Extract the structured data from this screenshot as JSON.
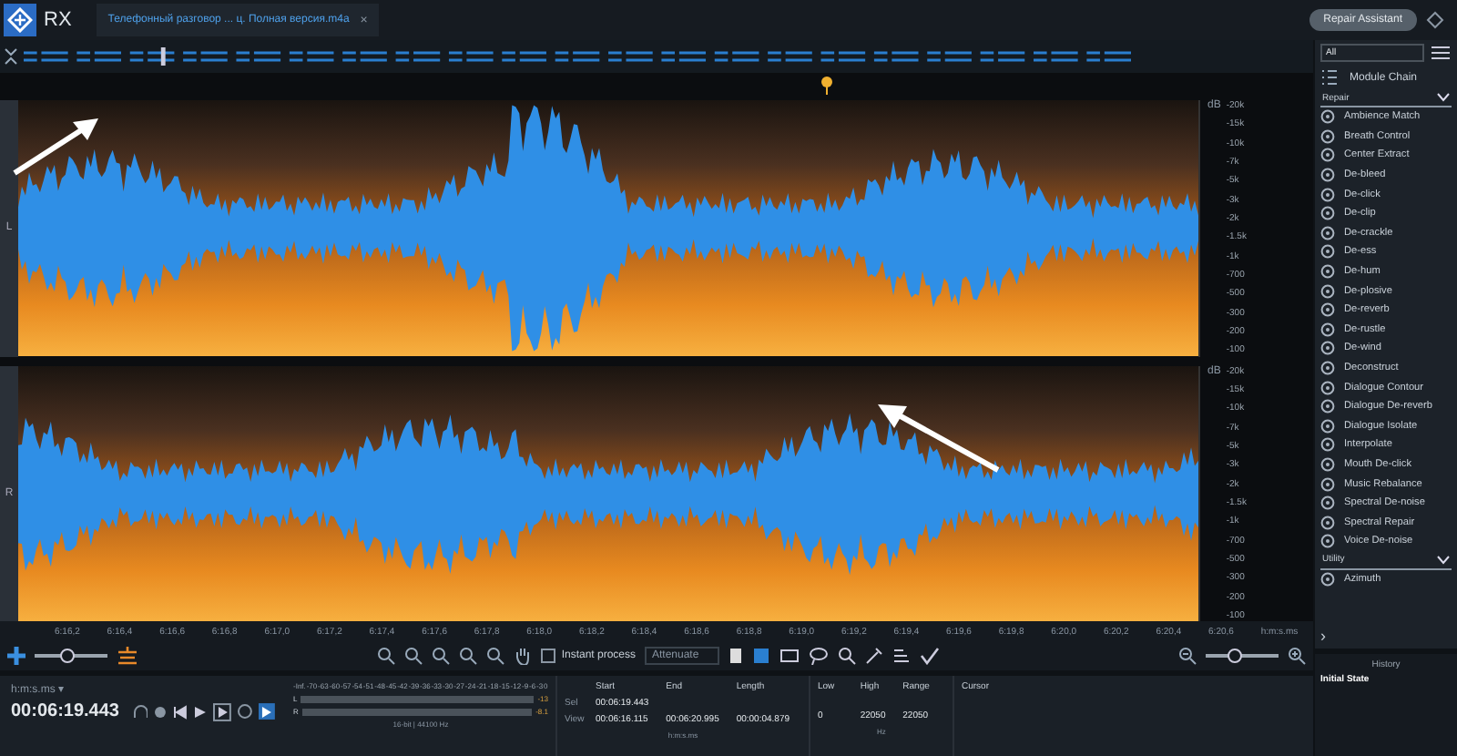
{
  "app": {
    "logo": "RX",
    "tab": {
      "title": "Телефонный разговор ... ц. Полная версия.m4a",
      "close": "×",
      "selected": true
    },
    "assistant_button": "Repair Assistant"
  },
  "channels": [
    {
      "label": "L",
      "db_label": "dB",
      "hz_ticks": [
        "-20k",
        "-15k",
        "-10k",
        "-7k",
        "-5k",
        "-3k",
        "-2k",
        "-1.5k",
        "-1k",
        "-700",
        "-500",
        "-300",
        "-200",
        "-100"
      ]
    },
    {
      "label": "R",
      "db_label": "dB",
      "hz_ticks": [
        "-20k",
        "-15k",
        "-10k",
        "-7k",
        "-5k",
        "-3k",
        "-2k",
        "-1.5k",
        "-1k",
        "-700",
        "-500",
        "-300",
        "-200",
        "-100"
      ]
    }
  ],
  "ruler": {
    "ticks": [
      "6:16,2",
      "6:16,4",
      "6:16,6",
      "6:16,8",
      "6:17,0",
      "6:17,2",
      "6:17,4",
      "6:17,6",
      "6:17,8",
      "6:18,0",
      "6:18,2",
      "6:18,4",
      "6:18,6",
      "6:18,8",
      "6:19,0",
      "6:19,2",
      "6:19,4",
      "6:19,6",
      "6:19,8",
      "6:20,0",
      "6:20,2",
      "6:20,4",
      "6:20,6"
    ],
    "unit": "h:m:s.ms"
  },
  "toolbar": {
    "left_zoom": {
      "level": 0.45
    },
    "instant_process": {
      "label": "Instant process",
      "checked": false
    },
    "mode": "Attenuate",
    "right_zoom": {
      "level": 0.4
    }
  },
  "transport": {
    "format": "h:m:s.ms ▾",
    "time": "00:06:19.443"
  },
  "meter": {
    "scale": [
      "-Inf.",
      "-70",
      "-63",
      "-60",
      "-57",
      "-54",
      "-51",
      "-48",
      "-45",
      "-42",
      "-39",
      "-36",
      "-33",
      "-30",
      "-27",
      "-24",
      "-21",
      "-18",
      "-15",
      "-12",
      "-9",
      "-6",
      "-3",
      "0"
    ],
    "channels": [
      {
        "label": "L",
        "peak": "-13"
      },
      {
        "label": "R",
        "peak": "-8.1"
      }
    ],
    "format": "16-bit | 44100 Hz"
  },
  "selection": {
    "headers": [
      "Start",
      "End",
      "Length"
    ],
    "rows": [
      {
        "label": "Sel",
        "values": [
          "00:06:19.443"
        ]
      },
      {
        "label": "View",
        "values": [
          "00:06:16.115",
          "00:06:20.995",
          "00:00:04.879"
        ]
      }
    ],
    "unit": "h:m:s.ms",
    "freq_headers": [
      "Low",
      "High",
      "Range"
    ],
    "freq_values": [
      "0",
      "22050",
      "22050"
    ],
    "freq_unit": "Hz",
    "cursor_header": "Cursor"
  },
  "sidebar": {
    "filter": "All",
    "chain": "Module Chain",
    "groups": [
      {
        "name": "Repair",
        "expanded": true,
        "modules": [
          "Ambience Match",
          "Breath Control",
          "Center Extract",
          "De-bleed",
          "De-click",
          "De-clip",
          "De-crackle",
          "De-ess",
          "De-hum",
          "De-plosive",
          "De-reverb",
          "De-rustle",
          "De-wind",
          "Deconstruct",
          "Dialogue Contour",
          "Dialogue De-reverb",
          "Dialogue Isolate",
          "Interpolate",
          "Mouth De-click",
          "Music Rebalance",
          "Spectral De-noise",
          "Spectral Repair",
          "Voice De-noise"
        ]
      },
      {
        "name": "Utility",
        "expanded": true,
        "modules": [
          "Azimuth"
        ]
      }
    ],
    "more": "›"
  },
  "history": {
    "title": "History",
    "items": [
      {
        "label": "Initial State",
        "selected": true
      }
    ]
  }
}
